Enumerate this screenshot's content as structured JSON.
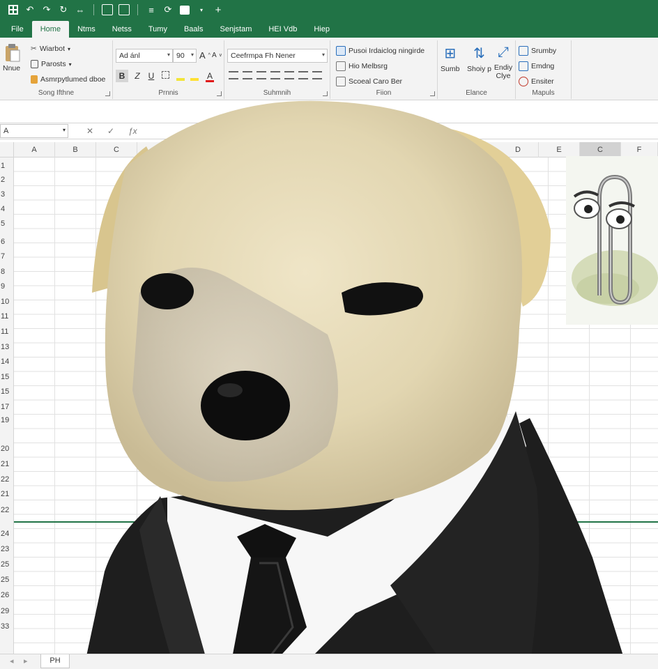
{
  "quick_access": {
    "icons": [
      "excel-logo-icon",
      "undo-icon",
      "redo-icon",
      "repeat-icon",
      "touch-mode-icon",
      "save-icon",
      "layout-icon",
      "autosave-icon",
      "comment-icon",
      "dropdown-icon",
      "add-icon"
    ],
    "add_glyph": "+"
  },
  "tabs": [
    "File",
    "Home",
    "Ntms",
    "Netss",
    "Tumy",
    "Baals",
    "Senjstam",
    "HEI Vdb",
    "Hiep"
  ],
  "active_tab": "Home",
  "ribbon": {
    "clipboard": {
      "paste_label": "Nnue",
      "items": [
        "Wiarbot",
        "Parosts",
        "Asmrpytlumed dboe"
      ],
      "group_label": "Song Ifthne"
    },
    "font": {
      "font_name": "Ad ánl",
      "font_size": "90",
      "bold": "B",
      "italic": "Z",
      "underline": "U",
      "group_label": "Prnnis"
    },
    "alignment": {
      "style_box": "Ceefrmpa Fh Nener",
      "group_label": "Suhmnih"
    },
    "number": {
      "items": [
        "Pusoi Irdaiclog ningirde",
        "Hio Melbsrg",
        "Scoeal Caro Ber"
      ],
      "group_label": "Fiion"
    },
    "editing": {
      "items": [
        "Sumb",
        "Shoiy p",
        "Endiy Clye"
      ],
      "group_label": "Elance"
    },
    "cells": {
      "items": [
        "Srumby",
        "Emdng",
        "Ensiter"
      ],
      "group_label": "Mapuls"
    }
  },
  "formula_bar": {
    "name_box": "A",
    "cancel": "✕",
    "enter": "✓",
    "fx": "ƒx"
  },
  "columns": [
    "A",
    "B",
    "C",
    "D",
    "E",
    "C",
    "F"
  ],
  "rows": [
    "1",
    "2",
    "3",
    "4",
    "5",
    "6",
    "7",
    "8",
    "9",
    "10",
    "11",
    "11",
    "13",
    "14",
    "15",
    "15",
    "17",
    "19",
    "20",
    "21",
    "22",
    "21",
    "22",
    "24",
    "23",
    "25",
    "25",
    "26",
    "29",
    "33"
  ],
  "sheet_tab": "PH",
  "colors": {
    "excel_green": "#217346",
    "ribbon_bg": "#f3f3f3",
    "gridline": "#e1e1e1",
    "suit": "#1c1c1c",
    "fur": "#e7dcb9"
  }
}
